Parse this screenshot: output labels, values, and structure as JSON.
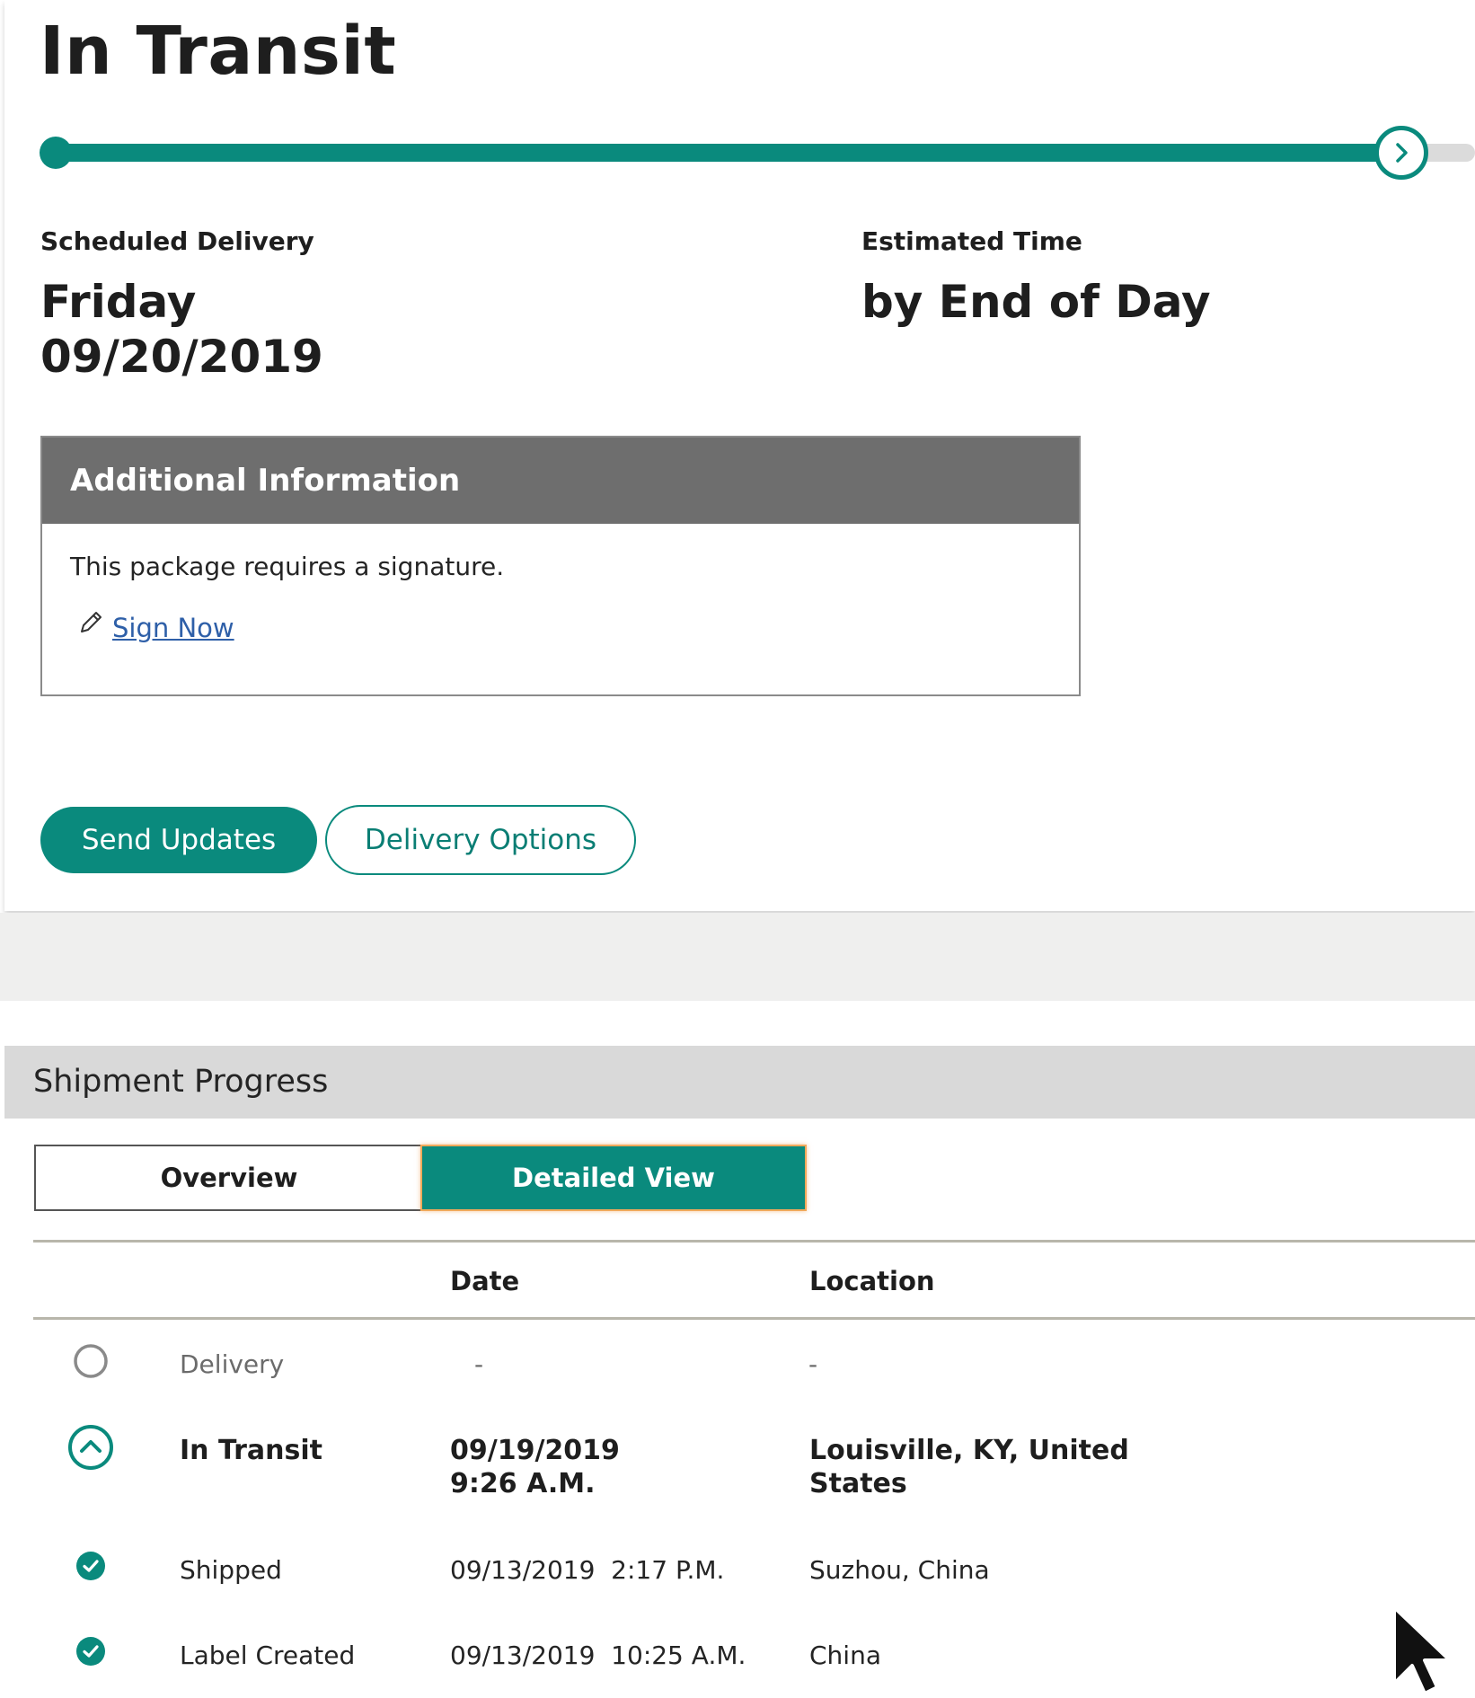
{
  "status": {
    "title": "In Transit",
    "progress_fraction": 0.95
  },
  "delivery": {
    "scheduled_label": "Scheduled Delivery",
    "scheduled_day": "Friday",
    "scheduled_date": "09/20/2019",
    "estimated_label": "Estimated Time",
    "estimated_value": "by End of Day"
  },
  "additional_info": {
    "header": "Additional Information",
    "text": "This package requires a signature.",
    "sign_link": "Sign Now"
  },
  "actions": {
    "send_updates": "Send Updates",
    "delivery_options": "Delivery Options"
  },
  "progress": {
    "title": "Shipment Progress",
    "tabs": [
      {
        "label": "Overview",
        "active": false
      },
      {
        "label": "Detailed View",
        "active": true
      }
    ],
    "columns": {
      "date": "Date",
      "location": "Location"
    },
    "rows": [
      {
        "status": "Delivery",
        "date": "-",
        "location": "-",
        "icon": "empty-circle-icon"
      },
      {
        "status": "In Transit",
        "date_line1": "09/19/2019",
        "date_line2": "9:26 A.M.",
        "location_line1": "Louisville, KY, United",
        "location_line2": "States",
        "icon": "chevron-up-circle-icon"
      },
      {
        "status": "Shipped",
        "date": "09/13/2019  2:17 P.M.",
        "location": "Suzhou, China",
        "icon": "check-circle-icon"
      },
      {
        "status": "Label Created",
        "date": "09/13/2019  10:25 A.M.",
        "location": "China",
        "icon": "check-circle-icon"
      }
    ]
  },
  "colors": {
    "accent": "#0a8a7d",
    "header_gray": "#6e6e6e",
    "link": "#2e5fa8"
  }
}
